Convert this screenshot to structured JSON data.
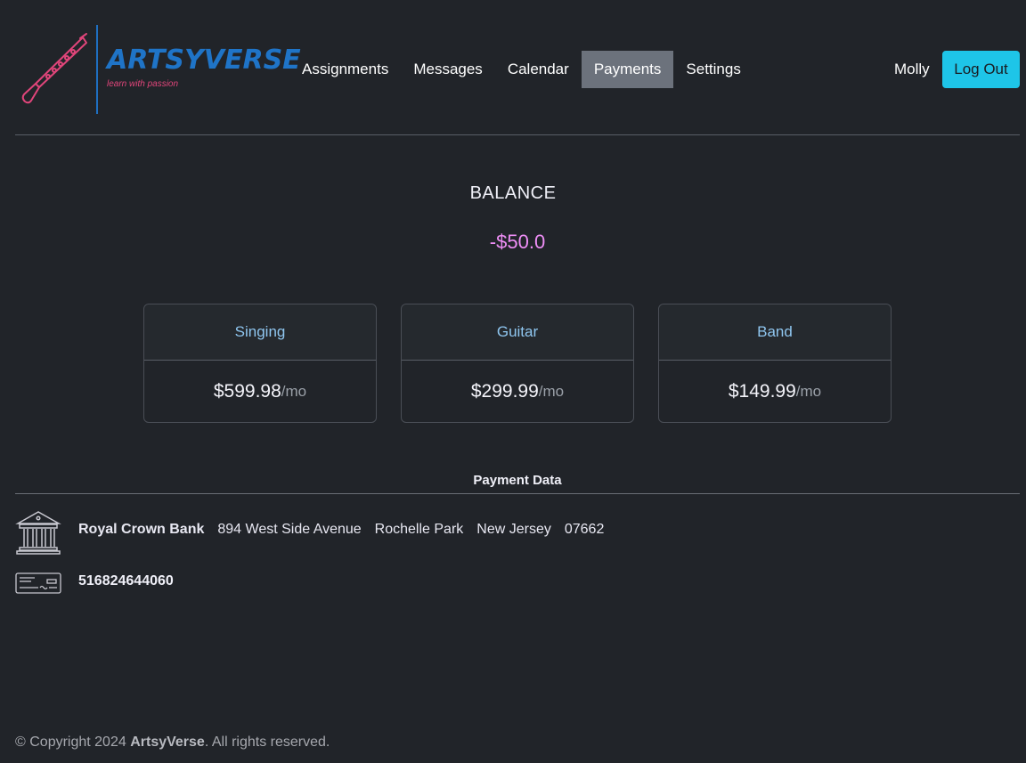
{
  "header": {
    "brand": "ARTSYVERSE",
    "tagline": "learn with passion",
    "nav": [
      "Assignments",
      "Messages",
      "Calendar",
      "Payments",
      "Settings"
    ],
    "active_nav": "Payments",
    "user": "Molly",
    "logout_label": "Log Out"
  },
  "balance": {
    "title": "BALANCE",
    "amount": "-$50.0"
  },
  "plans": [
    {
      "name": "Singing",
      "price": "$599.98",
      "period": "/mo"
    },
    {
      "name": "Guitar",
      "price": "$299.99",
      "period": "/mo"
    },
    {
      "name": "Band",
      "price": "$149.99",
      "period": "/mo"
    }
  ],
  "payment_data": {
    "title": "Payment Data",
    "bank_name": "Royal Crown Bank",
    "street": "894 West Side Avenue",
    "city": "Rochelle Park",
    "state": "New Jersey",
    "zip": "07662",
    "account_number": "516824644060"
  },
  "footer": {
    "prefix": "© Copyright 2024 ",
    "brand": "ArtsyVerse",
    "suffix": ". All rights reserved."
  },
  "colors": {
    "accent": "#1ec5e8",
    "balance": "#ee8ef5",
    "brand": "#1f74c7",
    "tagline": "#e0457a",
    "active_nav": "#6c727c"
  },
  "icons": {
    "logo": "clarinet-icon",
    "bank": "bank-icon",
    "check": "check-icon"
  }
}
